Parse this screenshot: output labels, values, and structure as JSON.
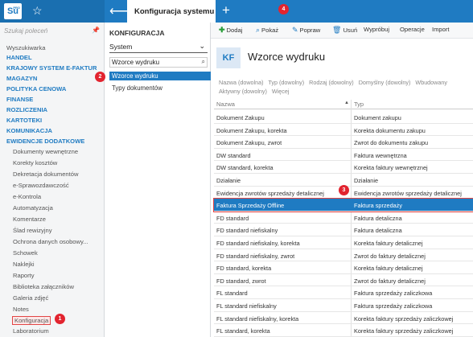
{
  "app": {
    "logo_text": "Su",
    "logo_small": "PRO",
    "active_tab": "Konfiguracja systemu",
    "accent": "#1f7bc2",
    "annotation_color": "#e2242f"
  },
  "leftnav": {
    "search_placeholder": "Szukaj poleceń",
    "items": [
      {
        "label": "Wyszukiwarka",
        "kind": "sub0"
      },
      {
        "label": "HANDEL",
        "kind": "group"
      },
      {
        "label": "KRAJOWY SYSTEM E-FAKTUR",
        "kind": "group"
      },
      {
        "label": "MAGAZYN",
        "kind": "group"
      },
      {
        "label": "POLITYKA CENOWA",
        "kind": "group"
      },
      {
        "label": "FINANSE",
        "kind": "group"
      },
      {
        "label": "ROZLICZENIA",
        "kind": "group"
      },
      {
        "label": "KARTOTEKI",
        "kind": "group"
      },
      {
        "label": "KOMUNIKACJA",
        "kind": "group"
      },
      {
        "label": "EWIDENCJE DODATKOWE",
        "kind": "group"
      },
      {
        "label": "Dokumenty wewnętrzne",
        "kind": "sub"
      },
      {
        "label": "Korekty kosztów",
        "kind": "sub"
      },
      {
        "label": "Dekretacja dokumentów",
        "kind": "sub"
      },
      {
        "label": "e-Sprawozdawczość",
        "kind": "sub"
      },
      {
        "label": "e-Kontrola",
        "kind": "sub"
      },
      {
        "label": "Automatyzacja",
        "kind": "sub"
      },
      {
        "label": "Komentarze",
        "kind": "sub"
      },
      {
        "label": "Ślad rewizyjny",
        "kind": "sub"
      },
      {
        "label": "Ochrona danych osobowy...",
        "kind": "sub"
      },
      {
        "label": "Schowek",
        "kind": "sub"
      },
      {
        "label": "Naklejki",
        "kind": "sub"
      },
      {
        "label": "Raporty",
        "kind": "sub"
      },
      {
        "label": "Biblioteka załączników",
        "kind": "sub"
      },
      {
        "label": "Galeria zdjęć",
        "kind": "sub"
      },
      {
        "label": "Notes",
        "kind": "sub"
      },
      {
        "label": "Konfiguracja",
        "kind": "sub"
      },
      {
        "label": "Laboratorium",
        "kind": "sub"
      }
    ]
  },
  "midcol": {
    "title": "KONFIGURACJA",
    "select_value": "System",
    "search_value": "Wzorce wydruku",
    "items": [
      "Wzorce wydruku",
      "Typy dokumentów"
    ]
  },
  "toolbar": {
    "add": "Dodaj",
    "show": "Pokaż",
    "edit": "Popraw",
    "delete": "Usuń",
    "try": "Wypróbuj",
    "operations": "Operacje",
    "import": "Import"
  },
  "main": {
    "badge": "KF",
    "title": "Wzorce wydruku",
    "filters": [
      "Nazwa (dowolna)",
      "Typ (dowolny)",
      "Rodzaj (dowolny)",
      "Domyślny (dowolny)",
      "Wbudowany",
      "Aktywny (dowolny)",
      "Więcej"
    ],
    "col_name": "Nazwa",
    "col_type": "Typ",
    "rows": [
      [
        "Dokument Zakupu",
        "Dokument zakupu"
      ],
      [
        "Dokument Zakupu, korekta",
        "Korekta dokumentu zakupu"
      ],
      [
        "Dokument Zakupu, zwrot",
        "Zwrot do dokumentu zakupu"
      ],
      [
        "DW standard",
        "Faktura wewnętrzna"
      ],
      [
        "DW standard, korekta",
        "Korekta faktury wewnętrznej"
      ],
      [
        "Działanie",
        "Działanie"
      ],
      [
        "Ewidencja zwrotów sprzedaży detalicznej",
        "Ewidencja zwrotów sprzedaży detalicznej"
      ],
      [
        "Faktura Sprzedaży Offline",
        "Faktura sprzedaży"
      ],
      [
        "FD standard",
        "Faktura detaliczna"
      ],
      [
        "FD standard niefiskalny",
        "Faktura detaliczna"
      ],
      [
        "FD standard niefiskalny, korekta",
        "Korekta faktury detalicznej"
      ],
      [
        "FD standard niefiskalny, zwrot",
        "Zwrot do faktury detalicznej"
      ],
      [
        "FD standard, korekta",
        "Korekta faktury detalicznej"
      ],
      [
        "FD standard, zwrot",
        "Zwrot do faktury detalicznej"
      ],
      [
        "FL standard",
        "Faktura sprzedaży zaliczkowa"
      ],
      [
        "FL standard niefiskalny",
        "Faktura sprzedaży zaliczkowa"
      ],
      [
        "FL standard niefiskalny, korekta",
        "Korekta faktury sprzedaży zaliczkowej"
      ],
      [
        "FL standard, korekta",
        "Korekta faktury sprzedaży zaliczkowej"
      ]
    ]
  },
  "badges": [
    "1",
    "2",
    "3",
    "4"
  ]
}
